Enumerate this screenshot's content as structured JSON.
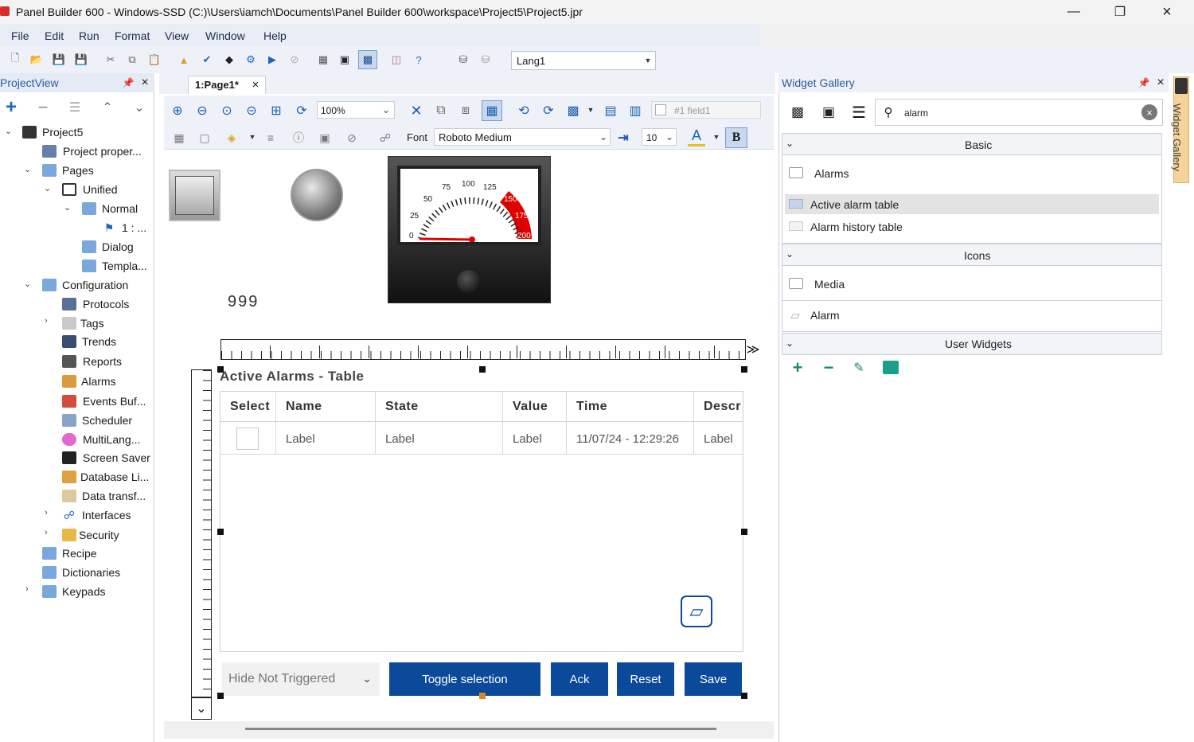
{
  "titlebar": {
    "title": "Panel Builder 600 - Windows-SSD (C:)\\Users\\iamch\\Documents\\Panel Builder 600\\workspace\\Project5\\Project5.jpr"
  },
  "menu": [
    "File",
    "Edit",
    "Run",
    "Format",
    "View",
    "Window",
    "Help"
  ],
  "toolbar": {
    "language": "Lang1"
  },
  "project_view": {
    "title": "ProjectView",
    "tree": {
      "project": "Project5",
      "project_properties": "Project proper...",
      "pages": "Pages",
      "unified": "Unified",
      "normal": "Normal",
      "page1": "1 : ...",
      "dialog": "Dialog",
      "templates": "Templa...",
      "configuration": "Configuration",
      "protocols": "Protocols",
      "tags": "Tags",
      "trends": "Trends",
      "reports": "Reports",
      "alarms": "Alarms",
      "events": "Events Buf...",
      "scheduler": "Scheduler",
      "multilang": "MultiLang...",
      "screensaver": "Screen Saver",
      "database": "Database Li...",
      "datatransfer": "Data transf...",
      "interfaces": "Interfaces",
      "security": "Security",
      "recipe": "Recipe",
      "dictionaries": "Dictionaries",
      "keypads": "Keypads"
    }
  },
  "editor": {
    "tab": "1:Page1*",
    "zoom": "100%",
    "field": "#1 field1",
    "font_label": "Font",
    "font": "Roboto Medium",
    "font_size": "10",
    "bold": "B"
  },
  "canvas": {
    "numeric_value": "999",
    "gauge": {
      "ticks": [
        "0",
        "25",
        "50",
        "75",
        "100",
        "125",
        "150",
        "175",
        "200"
      ],
      "value": 0
    },
    "alarm_table": {
      "title": "Active Alarms - Table",
      "columns": [
        "Select",
        "Name",
        "State",
        "Value",
        "Time",
        "Descr"
      ],
      "row": {
        "name": "Label",
        "state": "Label",
        "value": "Label",
        "time": "11/07/24 - 12:29:26",
        "descr": "Label"
      },
      "filter": "Hide Not Triggered",
      "buttons": {
        "toggle": "Toggle selection",
        "ack": "Ack",
        "reset": "Reset",
        "save": "Save"
      }
    }
  },
  "widget_gallery": {
    "title": "Widget Gallery",
    "search": "alarm",
    "sections": {
      "basic": "Basic",
      "icons": "Icons",
      "user": "User Widgets"
    },
    "basic_items": {
      "alarms_folder": "Alarms",
      "active_table": "Active alarm table",
      "history_table": "Alarm history table"
    },
    "icons_items": {
      "media": "Media",
      "alarm": "Alarm"
    },
    "side_tab": "Widget Gallery"
  },
  "colors": {
    "accent": "#0b4a9b",
    "gauge_red": "#e00000",
    "selection": "#dce6f5"
  }
}
